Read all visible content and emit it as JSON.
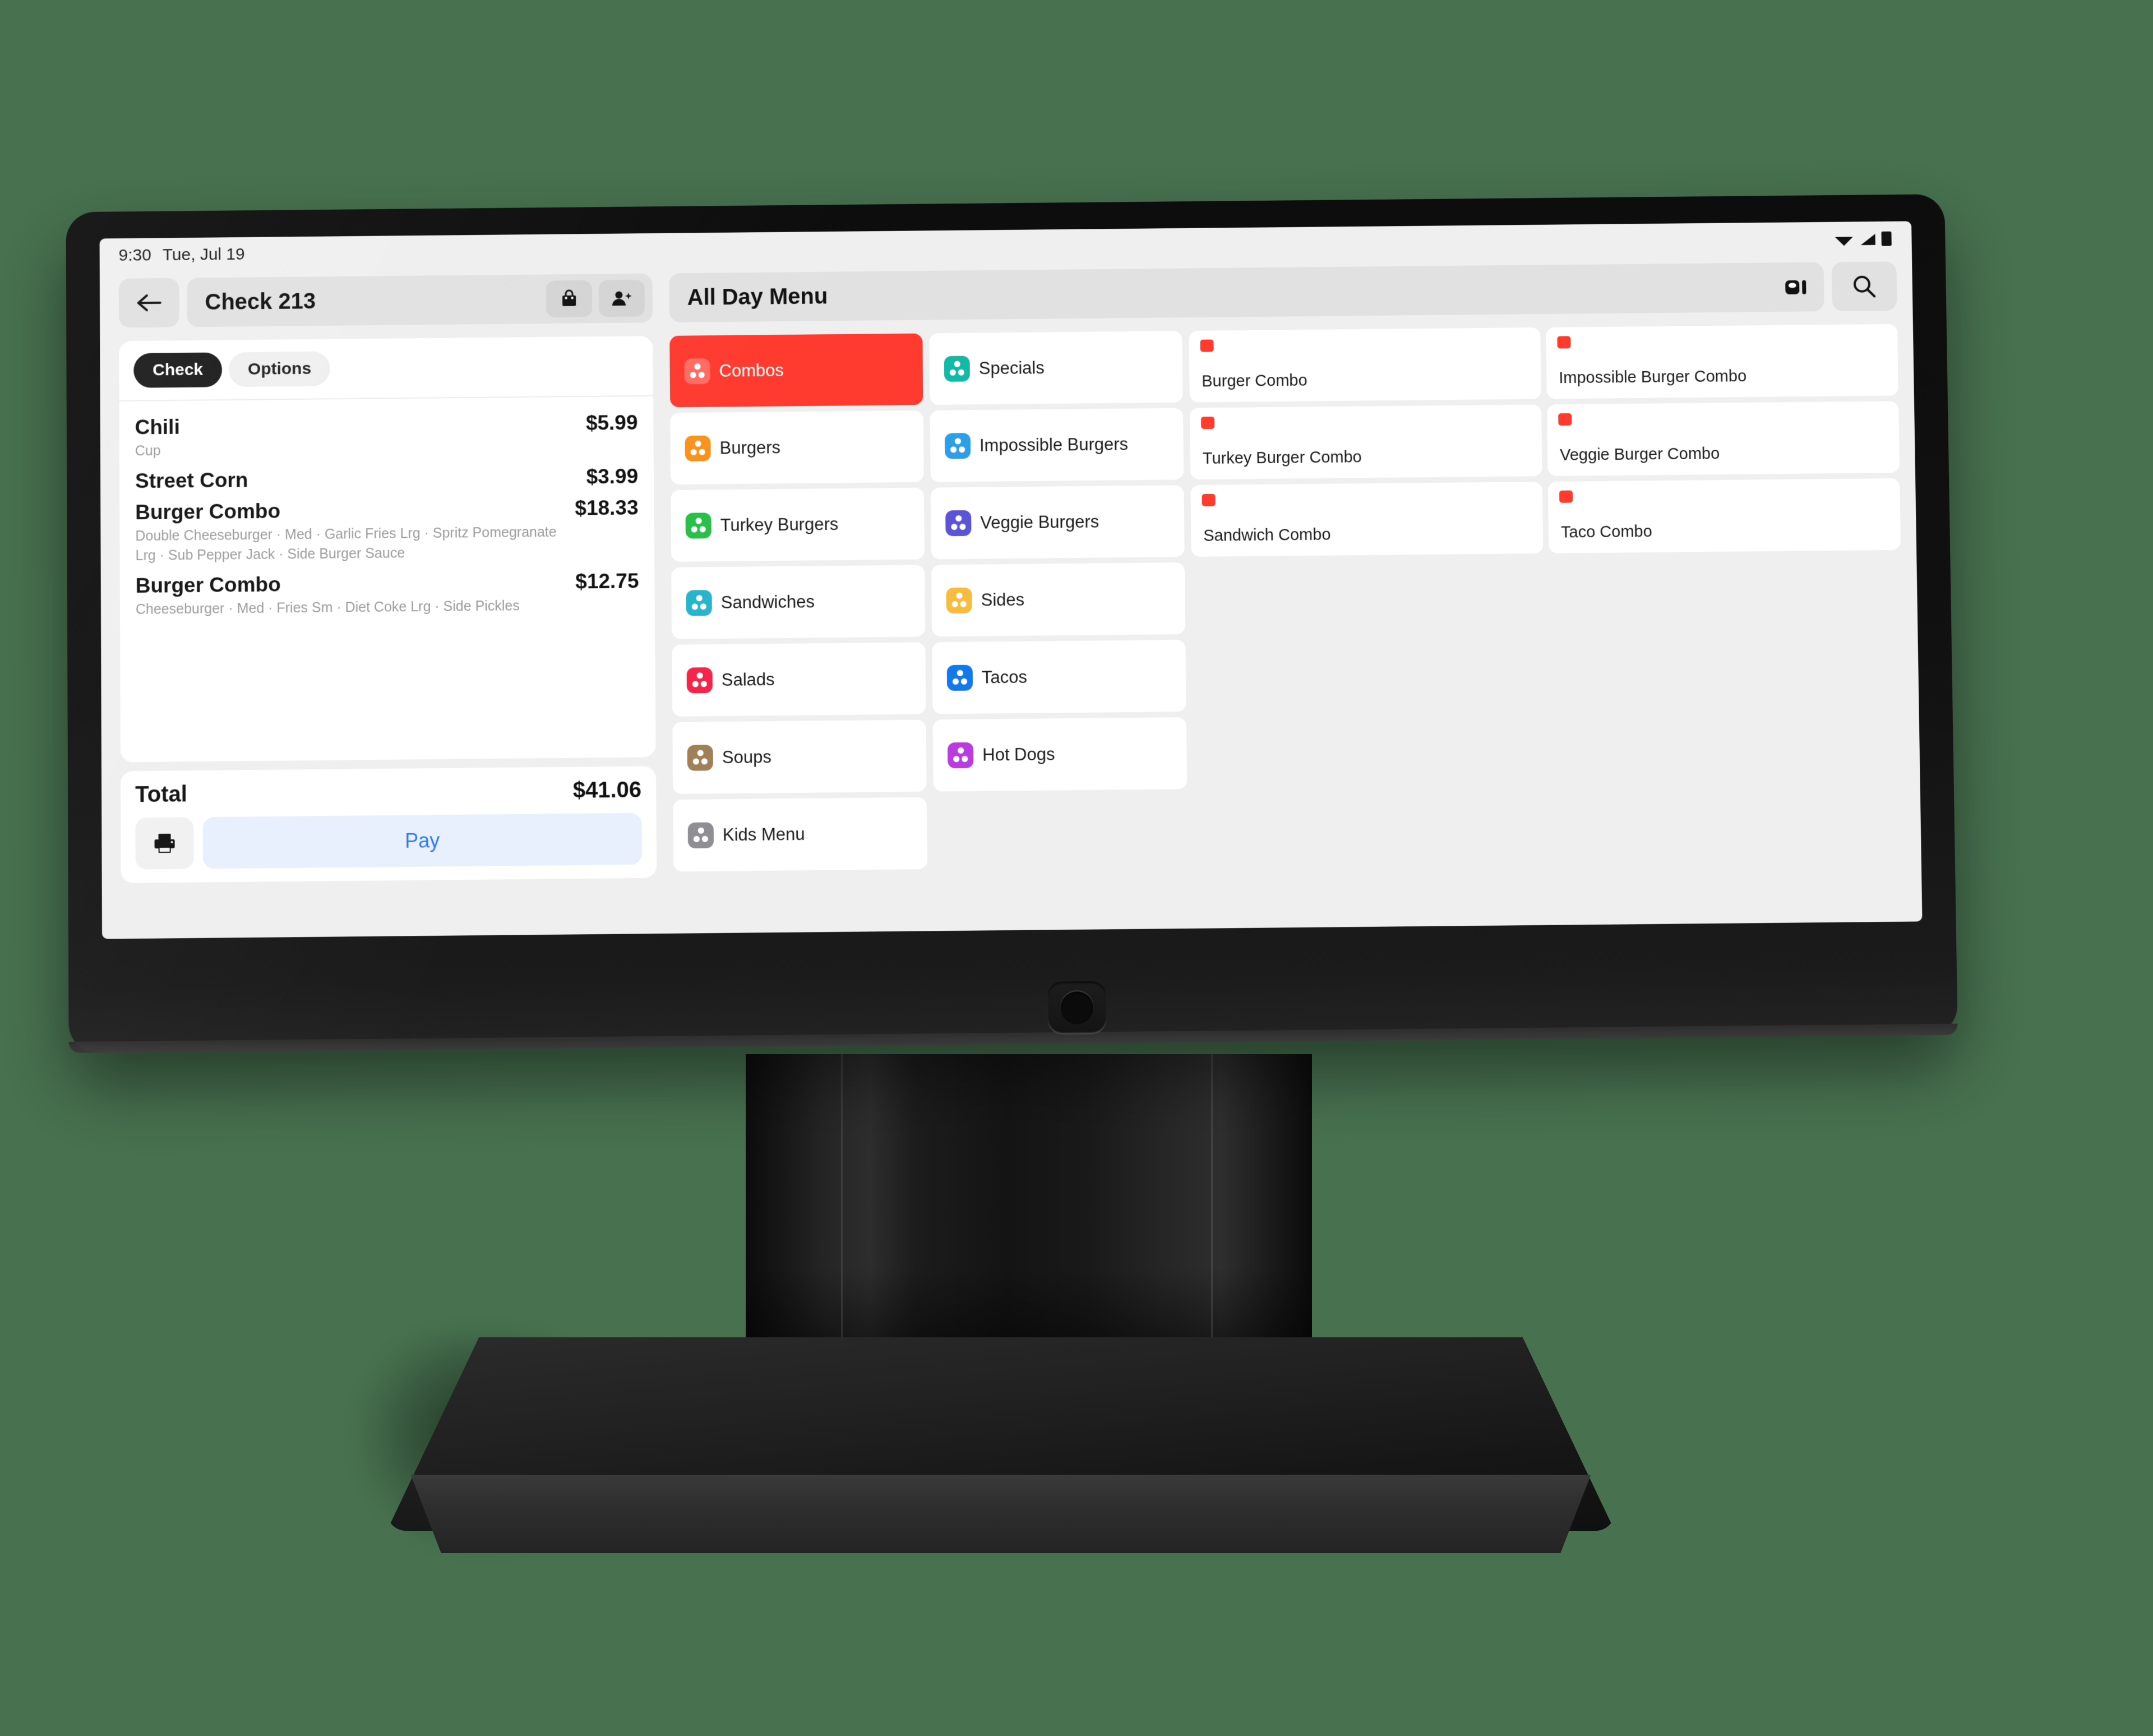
{
  "status_bar": {
    "time": "9:30",
    "date": "Tue, Jul 19",
    "icons": [
      "wifi-icon",
      "cellular-signal-icon",
      "battery-icon"
    ]
  },
  "check_panel": {
    "back_icon": "back-arrow-icon",
    "title": "Check 213",
    "actions": [
      {
        "name": "takeout-bag-button",
        "icon": "shopping-bag-icon"
      },
      {
        "name": "add-guest-button",
        "icon": "add-person-icon"
      }
    ],
    "tabs": [
      {
        "label": "Check",
        "active": true
      },
      {
        "label": "Options",
        "active": false
      }
    ],
    "items": [
      {
        "name": "Chili",
        "price": "$5.99",
        "mods": "Cup"
      },
      {
        "name": "Street Corn",
        "price": "$3.99",
        "mods": ""
      },
      {
        "name": "Burger Combo",
        "price": "$18.33",
        "mods": "Double Cheeseburger · Med · Garlic Fries Lrg · Spritz Pomegranate Lrg · Sub Pepper Jack · Side Burger Sauce"
      },
      {
        "name": "Burger Combo",
        "price": "$12.75",
        "mods": "Cheeseburger · Med · Fries Sm · Diet Coke Lrg · Side Pickles"
      }
    ],
    "total_label": "Total",
    "total_value": "$41.06",
    "print_icon": "printer-icon",
    "pay_label": "Pay",
    "pay_color": "#2f7af5"
  },
  "menu_panel": {
    "title": "All Day Menu",
    "layout_icon": "menu-layout-icon",
    "search_icon": "search-icon",
    "categories": [
      {
        "label": "Combos",
        "color": "#ff3b30",
        "active": true
      },
      {
        "label": "Specials",
        "color": "#14b8a6",
        "active": false
      },
      {
        "label": "Burgers",
        "color": "#f7931e",
        "active": false
      },
      {
        "label": "Impossible Burgers",
        "color": "#2f9fe5",
        "active": false
      },
      {
        "label": "Turkey Burgers",
        "color": "#29bf4a",
        "active": false
      },
      {
        "label": "Veggie Burgers",
        "color": "#5b54d6",
        "active": false
      },
      {
        "label": "Sandwiches",
        "color": "#27b4cc",
        "active": false
      },
      {
        "label": "Sides",
        "color": "#f7bb3f",
        "active": false
      },
      {
        "label": "Salads",
        "color": "#f2264b",
        "active": false
      },
      {
        "label": "Tacos",
        "color": "#1479e8",
        "active": false
      },
      {
        "label": "Soups",
        "color": "#a08059",
        "active": false
      },
      {
        "label": "Hot Dogs",
        "color": "#b93ce0",
        "active": false
      },
      {
        "label": "Kids Menu",
        "color": "#8e8e93",
        "active": false
      }
    ],
    "products": [
      {
        "label": "Burger Combo",
        "tag_color": "#ff3b30"
      },
      {
        "label": "Impossible Burger Combo",
        "tag_color": "#ff3b30"
      },
      {
        "label": "Turkey Burger Combo",
        "tag_color": "#ff3b30"
      },
      {
        "label": "Veggie Burger Combo",
        "tag_color": "#ff3b30"
      },
      {
        "label": "Sandwich Combo",
        "tag_color": "#ff3b30"
      },
      {
        "label": "Taco Combo",
        "tag_color": "#ff3b30"
      }
    ]
  },
  "device": {
    "home_button": "home-button",
    "background_color": "#47714f"
  }
}
